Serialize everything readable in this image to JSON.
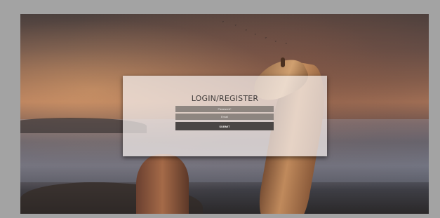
{
  "form": {
    "title": "LOGIN/REGISTER",
    "password_placeholder": "Password*",
    "email_placeholder": "Email",
    "submit_label": "SUBMIT"
  },
  "colors": {
    "modal_bg": "#f5f0ee",
    "field_bg": "#7d7672",
    "button_bg": "#4a4645",
    "frame_bg": "#a3a3a3"
  }
}
